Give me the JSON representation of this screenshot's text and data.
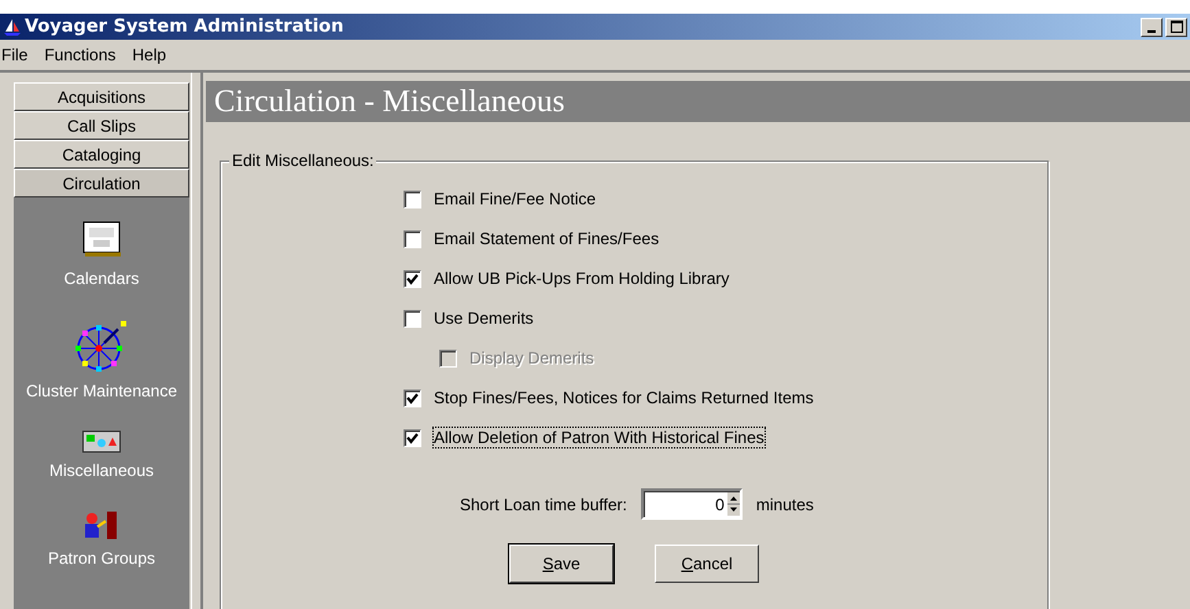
{
  "window": {
    "title": "Voyager System Administration"
  },
  "menu": [
    "File",
    "Functions",
    "Help"
  ],
  "modules": [
    {
      "label": "Acquisitions",
      "selected": false
    },
    {
      "label": "Call Slips",
      "selected": false
    },
    {
      "label": "Cataloging",
      "selected": false
    },
    {
      "label": "Circulation",
      "selected": true
    }
  ],
  "sidebar": {
    "items": [
      {
        "label": "Calendars"
      },
      {
        "label": "Cluster Maintenance"
      },
      {
        "label": "Miscellaneous"
      },
      {
        "label": "Patron Groups"
      }
    ]
  },
  "page": {
    "title": "Circulation - Miscellaneous"
  },
  "group": {
    "label": "Edit Miscellaneous:",
    "options": [
      {
        "label": "Email Fine/Fee Notice",
        "checked": false,
        "disabled": false,
        "focused": false
      },
      {
        "label": "Email Statement of Fines/Fees",
        "checked": false,
        "disabled": false,
        "focused": false
      },
      {
        "label": "Allow UB Pick-Ups From Holding Library",
        "checked": true,
        "disabled": false,
        "focused": false
      },
      {
        "label": "Use Demerits",
        "checked": false,
        "disabled": false,
        "focused": false,
        "children": [
          {
            "label": "Display Demerits",
            "checked": false,
            "disabled": true,
            "focused": false
          }
        ]
      },
      {
        "label": "Stop Fines/Fees, Notices for Claims Returned Items",
        "checked": true,
        "disabled": false,
        "focused": false
      },
      {
        "label": "Allow Deletion of Patron With Historical Fines",
        "checked": true,
        "disabled": false,
        "focused": true
      }
    ],
    "buffer": {
      "label": "Short Loan time buffer:",
      "value": "0",
      "unit": "minutes"
    },
    "buttons": [
      {
        "label": "Save",
        "default": true
      },
      {
        "label": "Cancel",
        "default": false
      }
    ]
  }
}
